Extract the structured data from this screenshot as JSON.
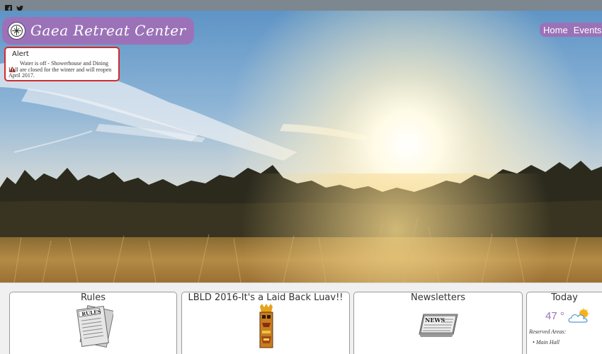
{
  "social": {
    "facebook_icon": "facebook-icon",
    "twitter_icon": "twitter-icon"
  },
  "header": {
    "site_title": "Gaea Retreat Center",
    "brand_color": "#9b72b8"
  },
  "nav": {
    "items": [
      {
        "label": "Home"
      },
      {
        "label": "Events"
      }
    ]
  },
  "alert": {
    "title": "Alert",
    "message": "Water is off - Showerhouse and Dining Hall are closed for the winter and will reopen April 2017.",
    "border_color": "#d12c2c"
  },
  "cards": [
    {
      "title": "Rules",
      "image": "rules-newspaper-icon"
    },
    {
      "title": "LBLD 2016-It's a Laid Back Luav!!",
      "image": "tiki-icon"
    },
    {
      "title": "Newsletters",
      "image": "news-newspaper-icon"
    }
  ],
  "weather": {
    "title": "Today",
    "temperature": "47 °",
    "icon": "partly-cloudy-icon",
    "reserved_label": "Reserved Areas:",
    "reserved_items": [
      "Main Hall"
    ]
  }
}
